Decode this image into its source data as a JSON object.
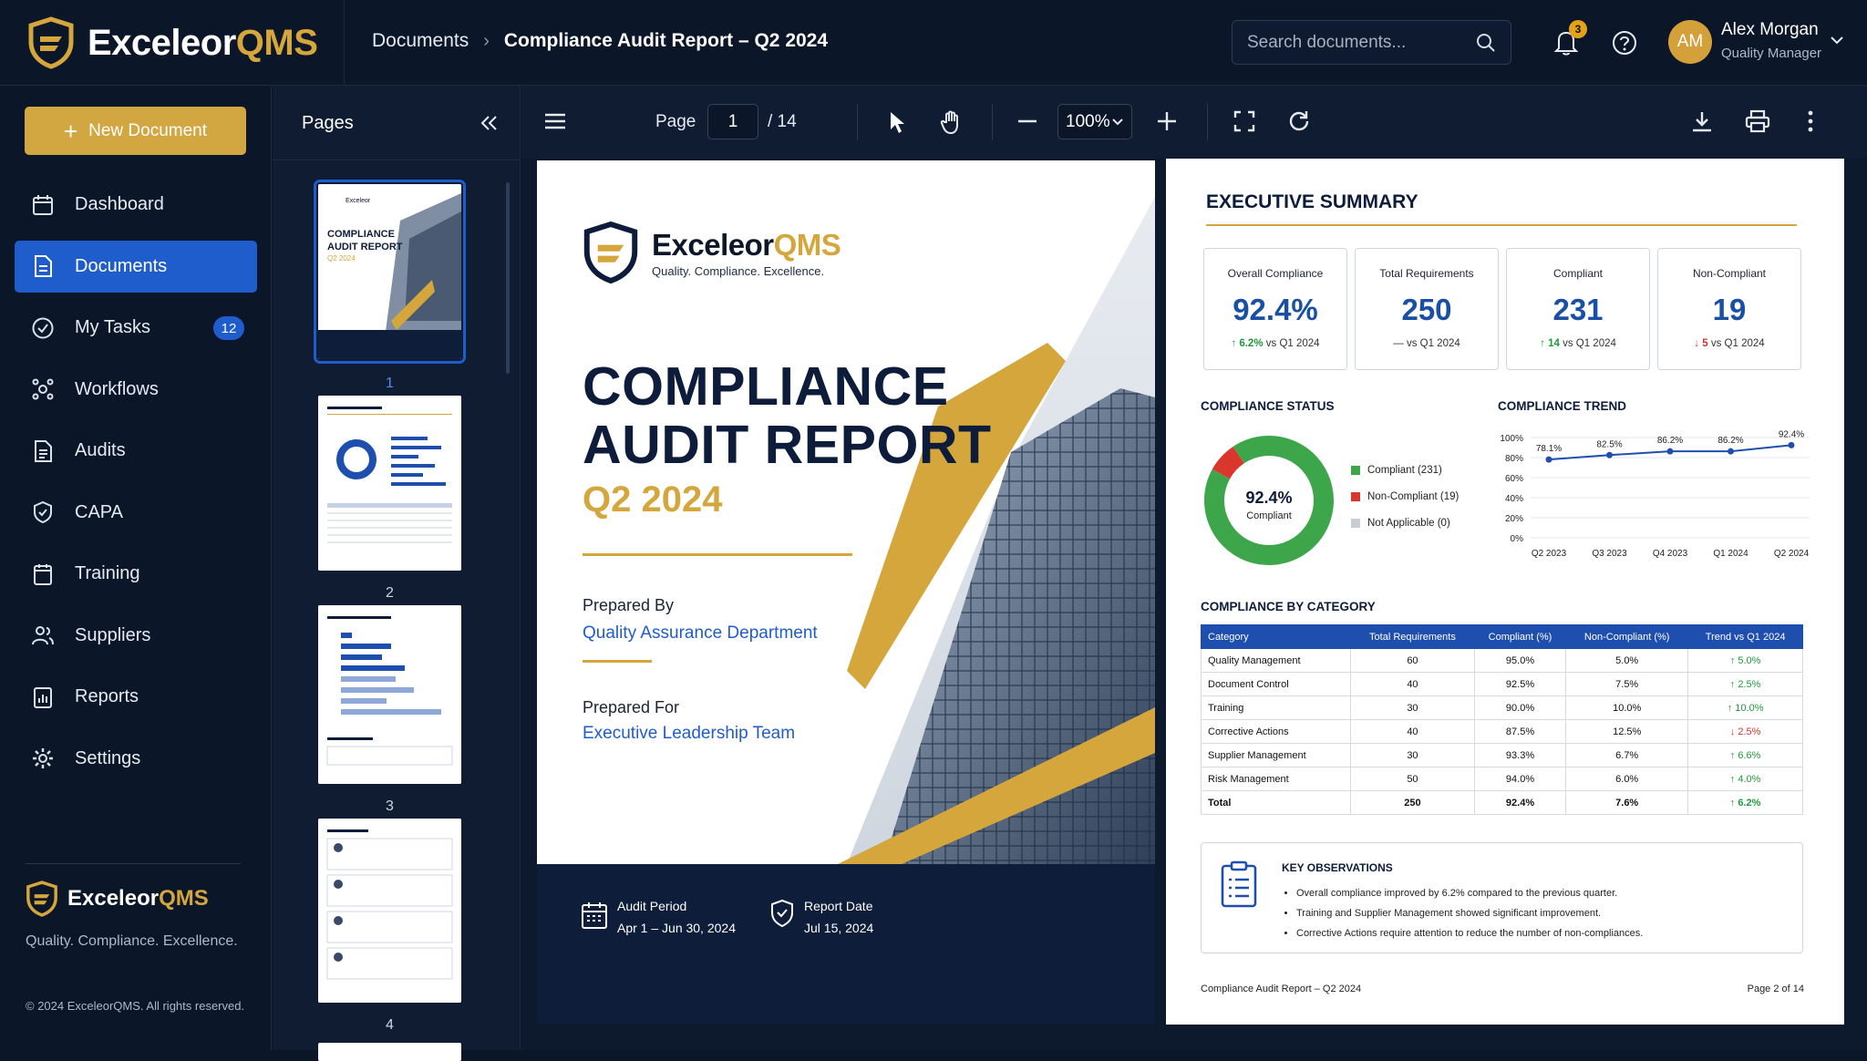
{
  "app": {
    "brand_a": "Exceleor",
    "brand_b": "QMS",
    "tagline": "Quality. Compliance. Excellence.",
    "copyright": "© 2024 ExceleorQMS. All rights reserved."
  },
  "breadcrumb": {
    "items": [
      "Documents",
      "Compliance Audit Report – Q2 2024"
    ]
  },
  "search": {
    "placeholder": "Search documents..."
  },
  "notifications": {
    "count": "3"
  },
  "user": {
    "initials": "AM",
    "name": "Alex Morgan",
    "role": "Quality Manager"
  },
  "sidebar": {
    "new_document": "New Document",
    "items": [
      {
        "label": "Dashboard",
        "icon": "dashboard-icon"
      },
      {
        "label": "Documents",
        "icon": "document-icon",
        "active": true
      },
      {
        "label": "My Tasks",
        "icon": "check-circle-icon",
        "count": "12"
      },
      {
        "label": "Workflows",
        "icon": "workflow-icon"
      },
      {
        "label": "Audits",
        "icon": "audit-icon"
      },
      {
        "label": "CAPA",
        "icon": "shield-check-icon"
      },
      {
        "label": "Training",
        "icon": "training-icon"
      },
      {
        "label": "Suppliers",
        "icon": "users-icon"
      },
      {
        "label": "Reports",
        "icon": "reports-icon"
      },
      {
        "label": "Settings",
        "icon": "gear-icon"
      }
    ]
  },
  "pages_panel": {
    "title": "Pages",
    "thumbs": [
      "1",
      "2",
      "3",
      "4"
    ]
  },
  "toolbar": {
    "page_label": "Page",
    "page_value": "1",
    "page_total": "/ 14",
    "zoom": "100%"
  },
  "cover": {
    "logo_a": "Exceleor",
    "logo_b": "QMS",
    "logo_tag": "Quality. Compliance. Excellence.",
    "title_1": "COMPLIANCE",
    "title_2": "AUDIT REPORT",
    "quarter": "Q2 2024",
    "prepared_by_label": "Prepared By",
    "prepared_by": "Quality Assurance Department",
    "prepared_for_label": "Prepared For",
    "prepared_for": "Executive Leadership Team",
    "audit_period_label": "Audit Period",
    "audit_period": "Apr 1 – Jun 30, 2024",
    "report_date_label": "Report Date",
    "report_date": "Jul 15, 2024"
  },
  "summary": {
    "heading": "EXECUTIVE SUMMARY",
    "kpis": [
      {
        "label": "Overall Compliance",
        "value": "92.4%",
        "delta": "6.2%",
        "trend": "up",
        "vs": "vs Q1 2024"
      },
      {
        "label": "Total Requirements",
        "value": "250",
        "delta": "—",
        "trend": "flat",
        "vs": "vs Q1 2024"
      },
      {
        "label": "Compliant",
        "value": "231",
        "delta": "14",
        "trend": "up",
        "vs": "vs Q1 2024"
      },
      {
        "label": "Non-Compliant",
        "value": "19",
        "delta": "5",
        "trend": "down",
        "vs": "vs Q1 2024"
      }
    ],
    "status_heading": "COMPLIANCE STATUS",
    "donut_value": "92.4%",
    "donut_label": "Compliant",
    "legend": [
      {
        "label": "Compliant (231)",
        "color": "#3ea64a"
      },
      {
        "label": "Non-Compliant (19)",
        "color": "#d9362e"
      },
      {
        "label": "Not Applicable (0)",
        "color": "#c8cdd4"
      }
    ],
    "trend_heading": "COMPLIANCE TREND",
    "category_heading": "COMPLIANCE BY CATEGORY",
    "table": {
      "headers": [
        "Category",
        "Total Requirements",
        "Compliant (%)",
        "Non-Compliant (%)",
        "Trend vs Q1 2024"
      ],
      "rows": [
        [
          "Quality Management",
          "60",
          "95.0%",
          "5.0%",
          "5.0%",
          "up"
        ],
        [
          "Document Control",
          "40",
          "92.5%",
          "7.5%",
          "2.5%",
          "up"
        ],
        [
          "Training",
          "30",
          "90.0%",
          "10.0%",
          "10.0%",
          "up"
        ],
        [
          "Corrective Actions",
          "40",
          "87.5%",
          "12.5%",
          "2.5%",
          "down"
        ],
        [
          "Supplier Management",
          "30",
          "93.3%",
          "6.7%",
          "6.6%",
          "up"
        ],
        [
          "Risk Management",
          "50",
          "94.0%",
          "6.0%",
          "4.0%",
          "up"
        ],
        [
          "Total",
          "250",
          "92.4%",
          "7.6%",
          "6.2%",
          "up"
        ]
      ]
    },
    "observations_heading": "KEY OBSERVATIONS",
    "observations": [
      "Overall compliance improved by 6.2% compared to the previous quarter.",
      "Training and Supplier Management showed significant improvement.",
      "Corrective Actions require attention to reduce the number of non-compliances."
    ],
    "footer_left": "Compliance Audit Report – Q2 2024",
    "footer_right": "Page 2 of 14"
  },
  "chart_data": [
    {
      "type": "pie",
      "categories": [
        "Compliant",
        "Non-Compliant",
        "Not Applicable"
      ],
      "values": [
        231,
        19,
        0
      ],
      "colors": [
        "#3ea64a",
        "#d9362e",
        "#c8cdd4"
      ]
    },
    {
      "type": "line",
      "title": "COMPLIANCE TREND",
      "x": [
        "Q2 2023",
        "Q3 2023",
        "Q4 2023",
        "Q1 2024",
        "Q2 2024"
      ],
      "series": [
        {
          "values": [
            78.1,
            82.5,
            86.2,
            86.2,
            92.4
          ],
          "labels": [
            "78.1%",
            "82.5%",
            "86.2%",
            "86.2%",
            "92.4%"
          ]
        }
      ],
      "yticks": [
        "0%",
        "20%",
        "40%",
        "60%",
        "80%",
        "100%"
      ],
      "ylim": [
        0,
        100
      ],
      "grid": true,
      "color": "#1f4fae"
    }
  ]
}
